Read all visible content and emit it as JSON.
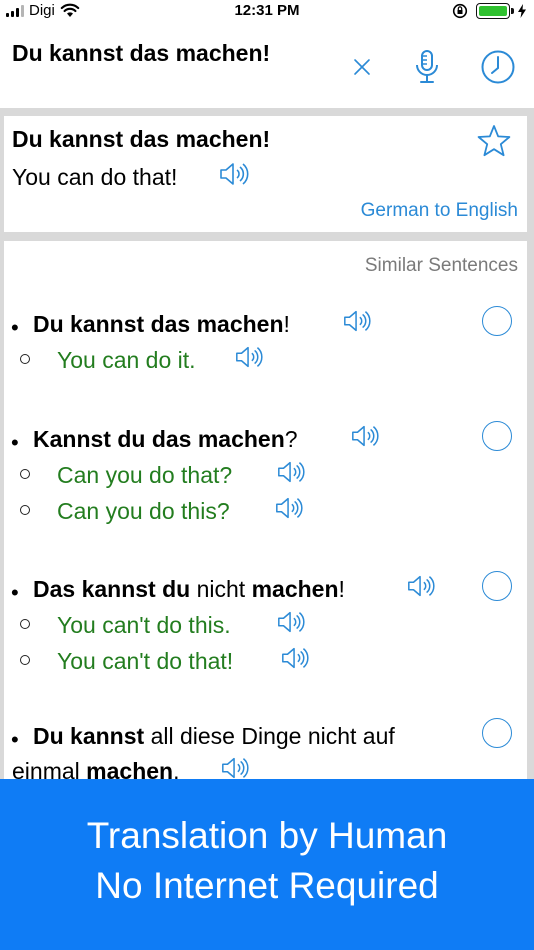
{
  "status_bar": {
    "carrier": "Digi",
    "time": "12:31 PM"
  },
  "search": {
    "query": "Du kannst das machen!"
  },
  "result": {
    "source": "Du kannst das machen!",
    "translation": "You can do that!",
    "direction_link": "German to English"
  },
  "similar": {
    "header": "Similar Sentences",
    "items": [
      {
        "de": [
          {
            "t": "Du kannst das machen",
            "b": true
          },
          {
            "t": "!",
            "b": false
          }
        ],
        "en": [
          "You can do it."
        ]
      },
      {
        "de": [
          {
            "t": "Kannst du das machen",
            "b": true
          },
          {
            "t": "?",
            "b": false
          }
        ],
        "en": [
          "Can you do that?",
          "Can you do this?"
        ]
      },
      {
        "de": [
          {
            "t": "Das kannst du",
            "b": true
          },
          {
            "t": " nicht ",
            "b": false
          },
          {
            "t": "machen",
            "b": true
          },
          {
            "t": "!",
            "b": false
          }
        ],
        "en": [
          "You can't do this.",
          "You can't do that!"
        ]
      },
      {
        "de": [
          {
            "t": "Du kannst",
            "b": true
          },
          {
            "t": " all diese Dinge nicht auf",
            "b": false
          }
        ],
        "de_line2": [
          {
            "t": "einmal ",
            "b": false
          },
          {
            "t": "machen",
            "b": true
          },
          {
            "t": ".",
            "b": false
          }
        ],
        "en": []
      }
    ]
  },
  "banner": {
    "line1": "Translation by Human",
    "line2": "No Internet Required",
    "color": "#0f7cf5"
  },
  "colors": {
    "accent": "#2b8ad6",
    "translation_green": "#237d1f",
    "divider": "#d9d9d9"
  }
}
